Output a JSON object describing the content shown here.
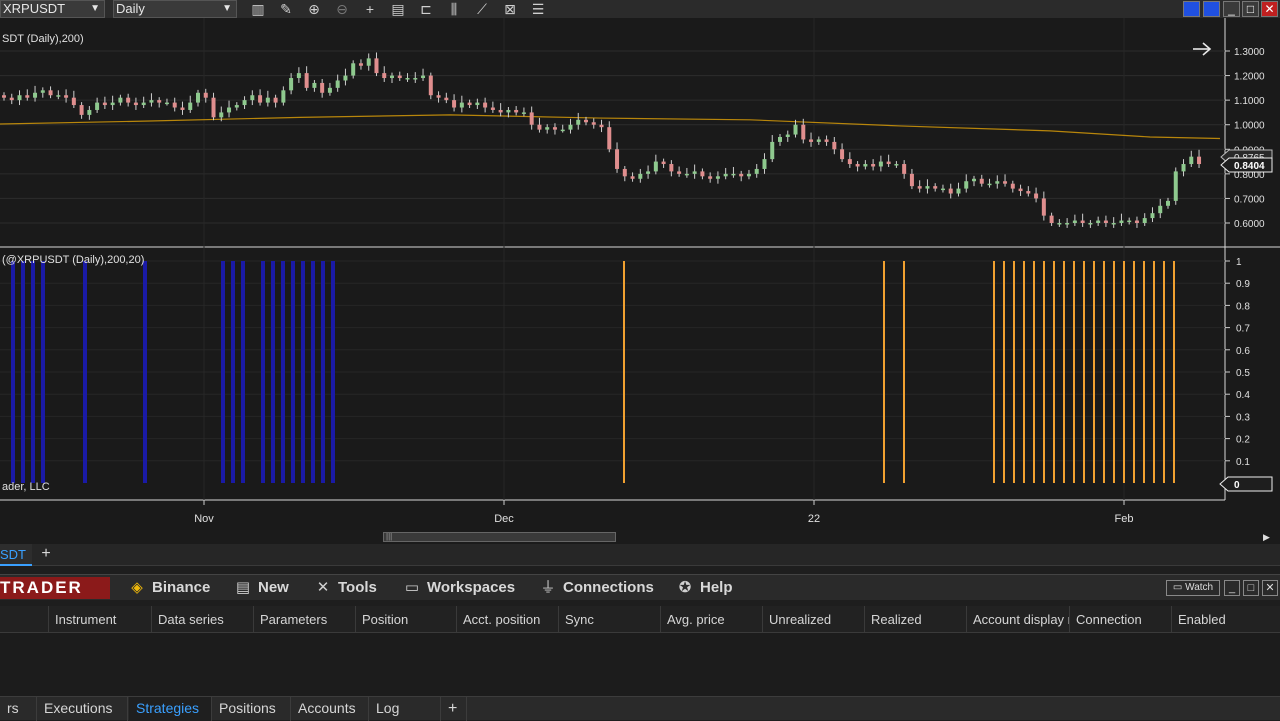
{
  "toolbar": {
    "instrument": "XRPUSDT",
    "interval": "Daily",
    "icons": [
      "bar-type-icon",
      "draw-icon",
      "zoom-in-icon",
      "zoom-out-icon",
      "crosshair-icon",
      "data-box-icon",
      "templates-icon",
      "indicators-icon",
      "strategies-icon",
      "properties-icon",
      "list-icon"
    ]
  },
  "chart": {
    "price_panel_label": "SDT (Daily),200)",
    "indicator_panel_label": "(@XRPUSDT (Daily),200,20)",
    "copyright": "ader, LLC",
    "price_ticks": [
      "1.3000",
      "1.2000",
      "1.1000",
      "1.0000",
      "0.9000",
      "0.8000",
      "0.7000",
      "0.6000"
    ],
    "price_marker_upper": "0.8765",
    "price_marker_lower": "0.8404",
    "indicator_ticks": [
      "1",
      "0.9",
      "0.8",
      "0.7",
      "0.6",
      "0.5",
      "0.4",
      "0.3",
      "0.2",
      "0.1"
    ],
    "indicator_marker": "0",
    "date_labels": [
      "Nov",
      "Dec",
      "22",
      "Feb"
    ],
    "colors": {
      "up": "#8ec98e",
      "down": "#e08e8e",
      "sma": "#b8860b",
      "signal_blue": "#1a1aa6",
      "signal_orange": "#f0a030"
    }
  },
  "tab_strip": {
    "chart_tab": "SDT",
    "add": "+"
  },
  "control_center": {
    "brand": "TRADER",
    "menu": [
      {
        "label": "Binance",
        "icon": "binance-icon"
      },
      {
        "label": "New",
        "icon": "new-icon"
      },
      {
        "label": "Tools",
        "icon": "tools-icon"
      },
      {
        "label": "Workspaces",
        "icon": "workspaces-icon"
      },
      {
        "label": "Connections",
        "icon": "connections-icon"
      },
      {
        "label": "Help",
        "icon": "help-icon"
      }
    ],
    "watch": "Watch",
    "columns": [
      "Instrument",
      "Data series",
      "Parameters",
      "Position",
      "Acct. position",
      "Sync",
      "Avg. price",
      "Unrealized",
      "Realized",
      "Account display n",
      "Connection",
      "Enabled"
    ],
    "bottom_tabs": [
      "rs",
      "Executions",
      "Strategies",
      "Positions",
      "Accounts",
      "Log",
      "+"
    ],
    "active_tab": "Strategies"
  }
}
